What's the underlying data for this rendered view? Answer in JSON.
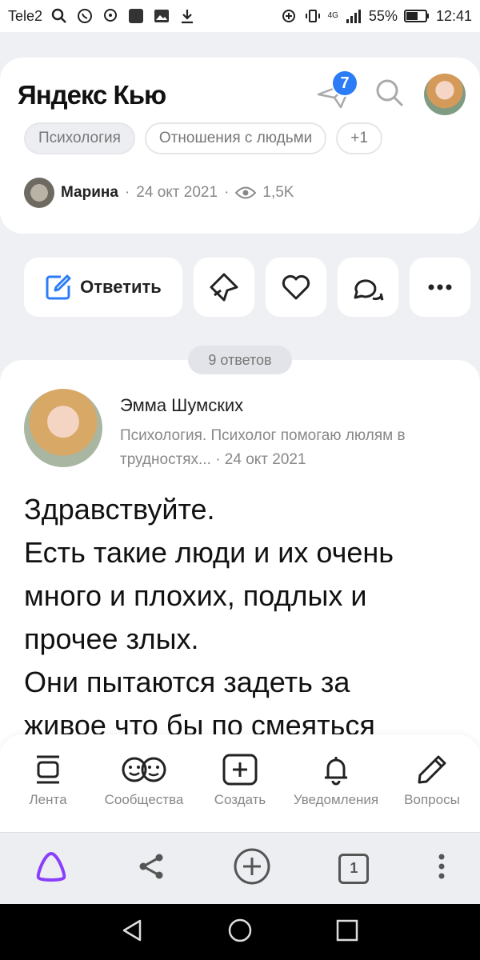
{
  "status": {
    "carrier": "Tele2",
    "battery": "55%",
    "time": "12:41",
    "network": "4G"
  },
  "header": {
    "logo": "Яндекс Кью",
    "notifications_count": "7"
  },
  "question": {
    "tags": [
      "Психология",
      "Отношения с людьми",
      "+1"
    ],
    "author": "Марина",
    "date": "24 окт 2021",
    "views": "1,5K"
  },
  "actions": {
    "answer_label": "Ответить"
  },
  "answers_count": "9 ответов",
  "answer": {
    "author": "Эмма Шумских",
    "bio": "Психология. Психолог помогаю люлям в трудностях...",
    "date": "24 окт 2021",
    "text_lines": [
      "Здравствуйте.",
      "Есть такие люди и их очень",
      "много и плохих, подлых и",
      "прочее злых.",
      "Они пытаются задеть за",
      "живое что бы по смеяться"
    ]
  },
  "bottom_nav": [
    {
      "label": "Лента",
      "icon": "feed-icon"
    },
    {
      "label": "Сообщества",
      "icon": "communities-icon"
    },
    {
      "label": "Создать",
      "icon": "create-icon"
    },
    {
      "label": "Уведомления",
      "icon": "bell-icon"
    },
    {
      "label": "Вопросы",
      "icon": "pencil-icon"
    }
  ],
  "browser": {
    "tabs_count": "1"
  },
  "colors": {
    "accent": "#2b7cf6",
    "alice": "#8a3ffc"
  }
}
